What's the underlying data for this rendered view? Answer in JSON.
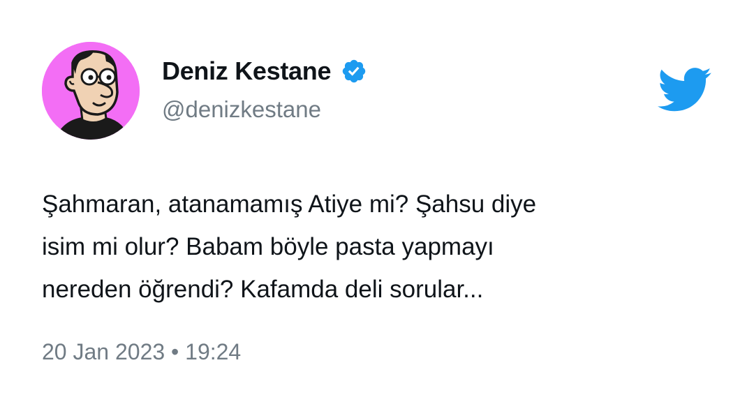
{
  "tweet": {
    "display_name": "Deniz Kestane",
    "handle": "@denizkestane",
    "verified_icon": "verified-badge-icon",
    "brand_icon": "twitter-bird-icon",
    "text": "Şahmaran, atanamamış Atiye mi? Şahsu diye\nisim mi olur? Babam böyle pasta yapmayı\nnereden öğrendi? Kafamda deli sorular...",
    "date": "20 Jan 2023",
    "separator": "•",
    "time": "19:24"
  },
  "colors": {
    "brand_blue": "#1d9bf0",
    "avatar_background": "#f36ef5",
    "secondary_text": "#707b84",
    "primary_text": "#0f1419"
  }
}
